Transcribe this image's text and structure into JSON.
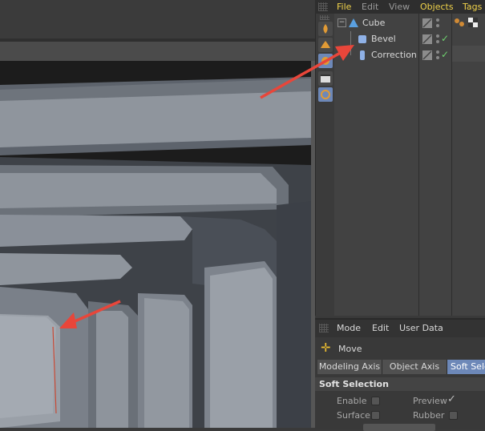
{
  "object_manager": {
    "menu": [
      "File",
      "Edit",
      "View",
      "Objects",
      "Tags"
    ],
    "objects": [
      {
        "name": "Cube",
        "level": 0
      },
      {
        "name": "Bevel",
        "level": 1
      },
      {
        "name": "Correction",
        "level": 1
      }
    ]
  },
  "attribute_manager": {
    "menu": [
      "Mode",
      "Edit",
      "User Data"
    ],
    "tool_name": "Move",
    "tabs": [
      "Modeling Axis",
      "Object Axis",
      "Soft Selection"
    ],
    "section_title": "Soft Selection",
    "options": [
      {
        "label": "Enable"
      },
      {
        "label": "Preview"
      },
      {
        "label": "Surface"
      },
      {
        "label": "Rubber"
      }
    ]
  },
  "colors": {
    "menu_accent": "#f0d24a",
    "arrow": "#e8463a",
    "active_tab": "#6d88b8"
  },
  "icons": [
    "grip-icon",
    "cube-icon",
    "bevel-deformer-icon",
    "correction-deformer-icon",
    "visibility-toggle-icon",
    "check-icon",
    "move-icon",
    "nav-move-icon",
    "nav-scale-icon",
    "nav-rotate-icon",
    "nav-maximize-icon"
  ]
}
